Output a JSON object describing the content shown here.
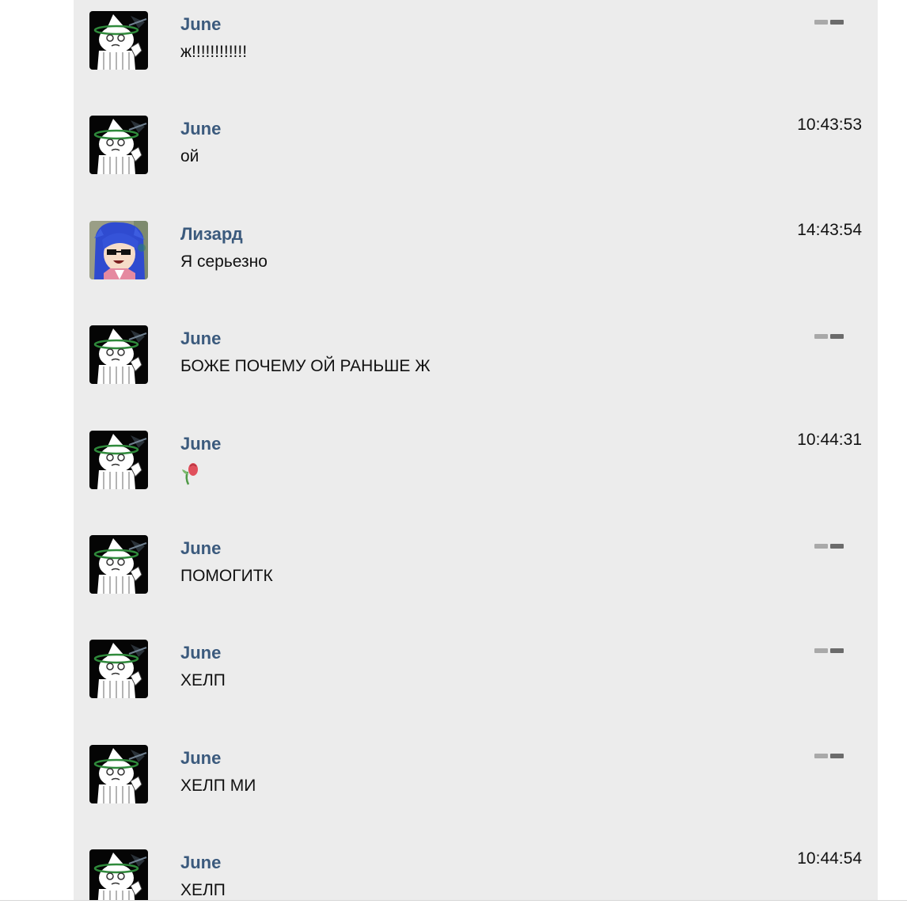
{
  "messages": [
    {
      "author": "June",
      "text": "ж!!!!!!!!!!!!",
      "time": "",
      "avatar": "june",
      "pending": true
    },
    {
      "author": "June",
      "text": "ой",
      "time": "10:43:53",
      "avatar": "june",
      "pending": false
    },
    {
      "author": "Лизард",
      "text": "Я серьезно",
      "time": "14:43:54",
      "avatar": "lizard",
      "pending": false
    },
    {
      "author": "June",
      "text": "БОЖЕ ПОЧЕМУ ОЙ РАНЬШЕ Ж",
      "time": "",
      "avatar": "june",
      "pending": true
    },
    {
      "author": "June",
      "text": "",
      "emoji": "rose-sticker",
      "time": "10:44:31",
      "avatar": "june",
      "pending": false
    },
    {
      "author": "June",
      "text": "ПОМОГИТК",
      "time": "",
      "avatar": "june",
      "pending": true
    },
    {
      "author": "June",
      "text": "ХЕЛП",
      "time": "",
      "avatar": "june",
      "pending": true
    },
    {
      "author": "June",
      "text": "ХЕЛП МИ",
      "time": "",
      "avatar": "june",
      "pending": true
    },
    {
      "author": "June",
      "text": "ХЕЛП",
      "time": "10:44:54",
      "avatar": "june",
      "pending": false
    }
  ],
  "colors": {
    "panel_background": "#ececec",
    "author_name": "#3b5a7d",
    "message_text": "#111111"
  }
}
